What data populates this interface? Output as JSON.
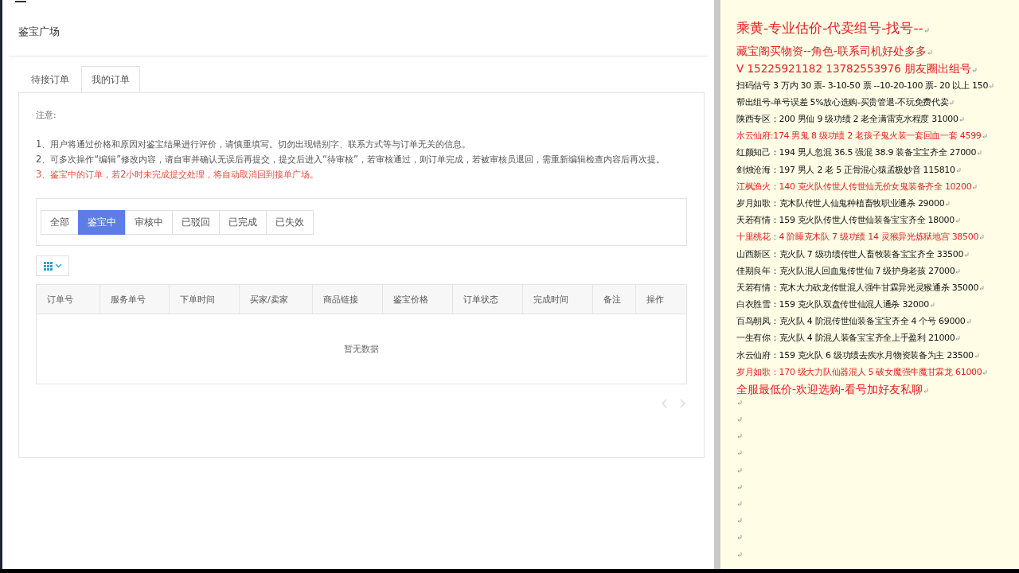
{
  "card": {
    "title": "鉴宝广场"
  },
  "tabs": [
    {
      "label": "待接订单",
      "selected": false
    },
    {
      "label": "我的订单",
      "selected": true
    }
  ],
  "notice": {
    "heading": "注意:",
    "items": [
      {
        "text": "1、用户将通过价格和原因对鉴宝结果进行评价，请慎重填写。切勿出现错别字、联系方式等与订单无关的信息。",
        "color": "#555555"
      },
      {
        "text": "2、可多次操作“编辑”修改内容，请自审并确认无误后再提交，提交后进入“待审核”，若审核通过，则订单完成，若被审核员退回，需重新编辑检查内容后再次提。",
        "color": "#555555"
      },
      {
        "text": "3、鉴宝中的订单，若2小时未完成提交处理，将自动取消回到接单广场。",
        "color": "#e84c3d"
      }
    ]
  },
  "filters": [
    {
      "label": "全部",
      "selected": false
    },
    {
      "label": "鉴宝中",
      "selected": true
    },
    {
      "label": "审核中",
      "selected": false
    },
    {
      "label": "已驳回",
      "selected": false
    },
    {
      "label": "已完成",
      "selected": false
    },
    {
      "label": "已失效",
      "selected": false
    }
  ],
  "table": {
    "columns": [
      "订单号",
      "服务单号",
      "下单时间",
      "买家/卖家",
      "商品链接",
      "鉴宝价格",
      "订单状态",
      "完成时间",
      "备注",
      "操作"
    ],
    "empty_text": "暂无数据"
  },
  "document": {
    "lines": [
      {
        "kind": "title",
        "text": "乘黄-专业估价-代卖组号-找号--",
        "color": "#e82020"
      },
      {
        "kind": "large",
        "text": "藏宝阁买物资--角色-联系司机好处多多",
        "color": "#e82020"
      },
      {
        "kind": "large",
        "text": "V 15225921182    13782553976 朋友圈出组号",
        "color": "#e82020"
      },
      {
        "kind": "line",
        "text": "扫码估号 3 万内 30 票- 3-10-50 票   --10-20-100 票- 20 以上 150",
        "color": "#111111"
      },
      {
        "kind": "line",
        "text": "帮出组号-单号误差 5%放心选购-买贵管退-不玩免费代卖",
        "color": "#111111"
      },
      {
        "kind": "line",
        "text": "陕西专区：200 男仙 9 级功绩 2 老全满雷克水程度 31000",
        "color": "#111111"
      },
      {
        "kind": "line",
        "text": "水云仙府:174 男鬼 8 级功绩 2 老孩子鬼火装一套回血一套 4599",
        "color": "#e82020"
      },
      {
        "kind": "line",
        "text": "红颜知己：194 男人忽混 36.5 强混 38.9 装备宝宝齐全 27000",
        "color": "#111111"
      },
      {
        "kind": "line",
        "text": "剑烛沧海：197 男人 2 老 5 正骨混心猿孟极妙音 115810",
        "color": "#111111"
      },
      {
        "kind": "line",
        "text": "江枫渔火：140 克火队传世人传世仙无价女鬼装备齐全 10200",
        "color": "#e82020"
      },
      {
        "kind": "line",
        "text": "岁月如歌：克木队传世人仙鬼种植畜牧职业通杀 29000",
        "color": "#111111"
      },
      {
        "kind": "line",
        "text": "天若有情：159 克火队传世人传世仙装备宝宝齐全 18000",
        "color": "#111111"
      },
      {
        "kind": "line",
        "text": "十里桃花：4 阶睡克木队 7 级功绩 14 灵猴异光炼狱地宫 38500",
        "color": "#e82020"
      },
      {
        "kind": "line",
        "text": "山西新区：克火队 7 级功绩传世人畜牧装备宝宝齐全 33500",
        "color": "#111111"
      },
      {
        "kind": "line",
        "text": "佳期良年：克火队混人回血鬼传世仙 7 级护身老孩 27000",
        "color": "#111111"
      },
      {
        "kind": "line",
        "text": "天若有情：克木大力砍龙传世混人强牛甘霖异光灵猴通杀 35000",
        "color": "#111111"
      },
      {
        "kind": "line",
        "text": "白衣胜雪：159 克火队双盘传世仙混人通杀 32000",
        "color": "#111111"
      },
      {
        "kind": "line",
        "text": "百鸟朝凤：克火队 4 阶混传世仙装备宝宝齐全 4 个号 69000",
        "color": "#111111"
      },
      {
        "kind": "line",
        "text": "一生有你：克火队 4 阶混人装备宝宝齐全上手盈利 21000",
        "color": "#111111"
      },
      {
        "kind": "line",
        "text": "水云仙府：159 克火队 6 级功绩去疾水月物资装备为主 23500",
        "color": "#111111"
      },
      {
        "kind": "line",
        "text": "岁月如歌：170 级大力队仙器混人 5 破女魔强牛魔甘霖龙 61000",
        "color": "#e82020"
      },
      {
        "kind": "large",
        "text": "全服最低价-欢迎选购-看号加好友私聊",
        "color": "#e82020"
      },
      {
        "kind": "blank"
      },
      {
        "kind": "blank"
      },
      {
        "kind": "blank"
      },
      {
        "kind": "blank"
      },
      {
        "kind": "blank"
      },
      {
        "kind": "blank"
      },
      {
        "kind": "blank"
      },
      {
        "kind": "blank"
      },
      {
        "kind": "blank"
      },
      {
        "kind": "blank"
      }
    ]
  }
}
